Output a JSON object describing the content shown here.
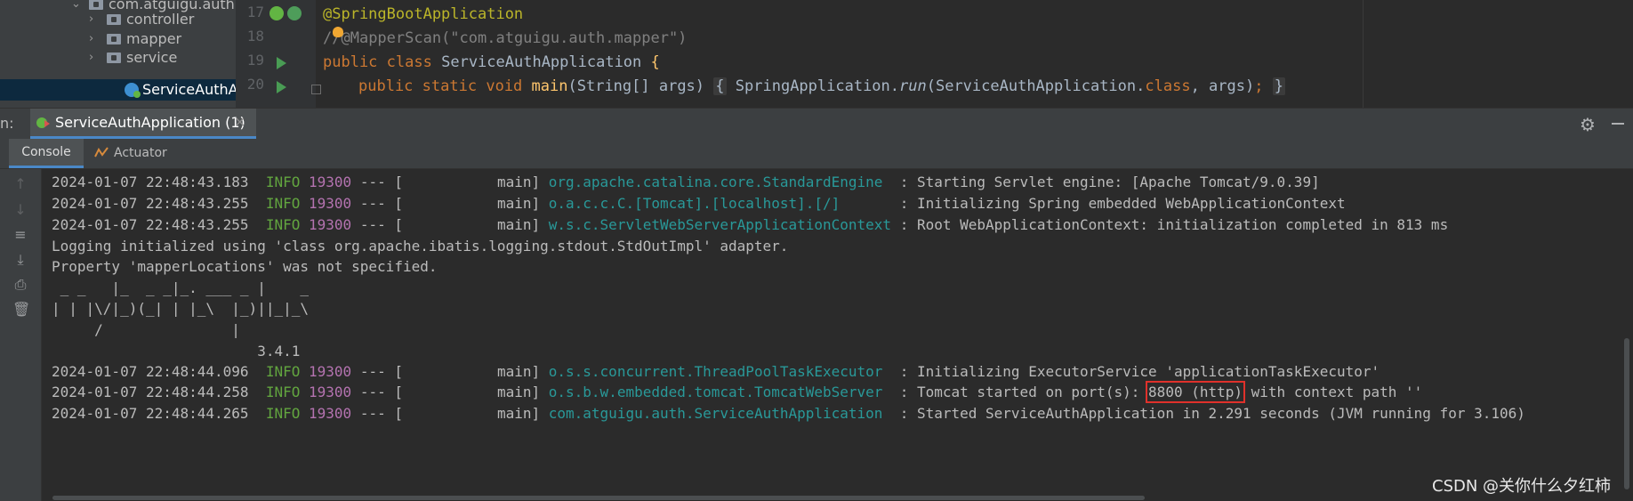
{
  "project_tree": {
    "items": [
      {
        "label": "com.atguigu.auth"
      },
      {
        "label": "controller"
      },
      {
        "label": "mapper"
      },
      {
        "label": "service"
      },
      {
        "label": "ServiceAuthApplication"
      }
    ]
  },
  "editor": {
    "line_numbers": [
      "17",
      "18",
      "19",
      "20"
    ],
    "line17": {
      "annotation": "@SpringBootApplication"
    },
    "line18": {
      "prefix": "/",
      "rest": "/@MapperScan(\"com.atguigu.auth.mapper\")"
    },
    "line19": {
      "kw1": "public",
      "kw2": "class",
      "name": "ServiceAuthApplication",
      "brace": "{"
    },
    "line20": {
      "kw1": "public",
      "kw2": "static",
      "kw3": "void",
      "method": "main",
      "params": "(String[] args)",
      "open": "{",
      "call_obj": "SpringApplication.",
      "call_method": "run",
      "call_arg_start": "(ServiceAuthApplication.",
      "call_kw": "class",
      "call_arg_end": ", args)",
      "semicolon": ";",
      "close": "}"
    }
  },
  "run_window": {
    "label": "n:",
    "tab_label": "ServiceAuthApplication (1)",
    "tab_close": "×",
    "sub_tabs": {
      "console": "Console",
      "actuator": "Actuator"
    }
  },
  "console": {
    "lines": [
      {
        "time": "2024-01-07 22:48:43.183",
        "level": "INFO",
        "pid": "19300",
        "thread": "--- [           main]",
        "logger": "org.apache.catalina.core.StandardEngine ",
        "msg": " : Starting Servlet engine: [Apache Tomcat/9.0.39]"
      },
      {
        "time": "2024-01-07 22:48:43.255",
        "level": "INFO",
        "pid": "19300",
        "thread": "--- [           main]",
        "logger": "o.a.c.c.C.[Tomcat].[localhost].[/]      ",
        "msg": " : Initializing Spring embedded WebApplicationContext"
      },
      {
        "time": "2024-01-07 22:48:43.255",
        "level": "INFO",
        "pid": "19300",
        "thread": "--- [           main]",
        "logger": "w.s.c.ServletWebServerApplicationContext",
        "msg": " : Root WebApplicationContext: initialization completed in 813 ms"
      }
    ],
    "plain_lines": [
      "Logging initialized using 'class org.apache.ibatis.logging.stdout.StdOutImpl' adapter.",
      "Property 'mapperLocations' was not specified."
    ],
    "banner": [
      " _ _   |_  _ _|_. ___ _ |    _ ",
      "| | |\\/|_)(_| | |_\\  |_)||_|_\\ ",
      "     /               |         ",
      "                        3.4.1 "
    ],
    "lines2": [
      {
        "time": "2024-01-07 22:48:44.096",
        "level": "INFO",
        "pid": "19300",
        "thread": "--- [           main]",
        "logger": "o.s.s.concurrent.ThreadPoolTaskExecutor ",
        "msg": " : Initializing ExecutorService 'applicationTaskExecutor'"
      },
      {
        "time": "2024-01-07 22:48:44.258",
        "level": "INFO",
        "pid": "19300",
        "thread": "--- [           main]",
        "logger": "o.s.b.w.embedded.tomcat.TomcatWebServer ",
        "msg_pre": " : Tomcat started on port(s): ",
        "msg_hl": "8800 (http)",
        "msg_post": " with context path ''"
      },
      {
        "time": "2024-01-07 22:48:44.265",
        "level": "INFO",
        "pid": "19300",
        "thread": "--- [           main]",
        "logger": "com.atguigu.auth.ServiceAuthApplication ",
        "msg": " : Started ServiceAuthApplication in 2.291 seconds (JVM running for 3.106)"
      }
    ]
  },
  "watermark": "CSDN @关你什么夕红柿",
  "colors": {
    "accent": "#4a88c7",
    "highlight_box": "#e0312b",
    "info": "#62a53f",
    "logger": "#299999"
  }
}
